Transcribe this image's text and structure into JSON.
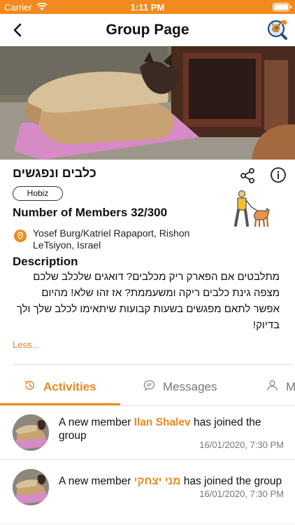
{
  "status_bar": {
    "carrier": "Carrier",
    "time": "1:11 PM"
  },
  "nav": {
    "title": "Group Page"
  },
  "group": {
    "name": "כלבים ונפגשים",
    "tag": "Hobiz",
    "members": "Number of Members 32/300",
    "location": "Yosef Burg/Katriel Rapaport, Rishon LeTsiyon, Israel",
    "description_title": "Description",
    "description": "מתלבטים אם הפארק ריק מכלבים? דואגים שלכלב שלכם מצפה גינת כלבים ריקה ומשעממת? אז זהו שלא! מהיום אפשר לתאם מפגשים בשעות קבועות שיתאימו לכלב שלך ולך בדיוק!",
    "less_label": "Less..."
  },
  "tabs": [
    {
      "label": "Activities",
      "icon": "history-icon"
    },
    {
      "label": "Messages",
      "icon": "chat-icon"
    },
    {
      "label": "M",
      "icon": "user-icon"
    }
  ],
  "feed": [
    {
      "prefix": "A new member ",
      "name": "Ilan Shalev",
      "suffix": " has joined the group",
      "time": "16/01/2020, 7:30 PM"
    },
    {
      "prefix": "A new member ",
      "name": "מני יצחקי",
      "suffix": " has joined the group",
      "time": "16/01/2020, 7:30 PM"
    }
  ],
  "colors": {
    "accent": "#f28a1e",
    "accent_text": "#e88a1f"
  }
}
